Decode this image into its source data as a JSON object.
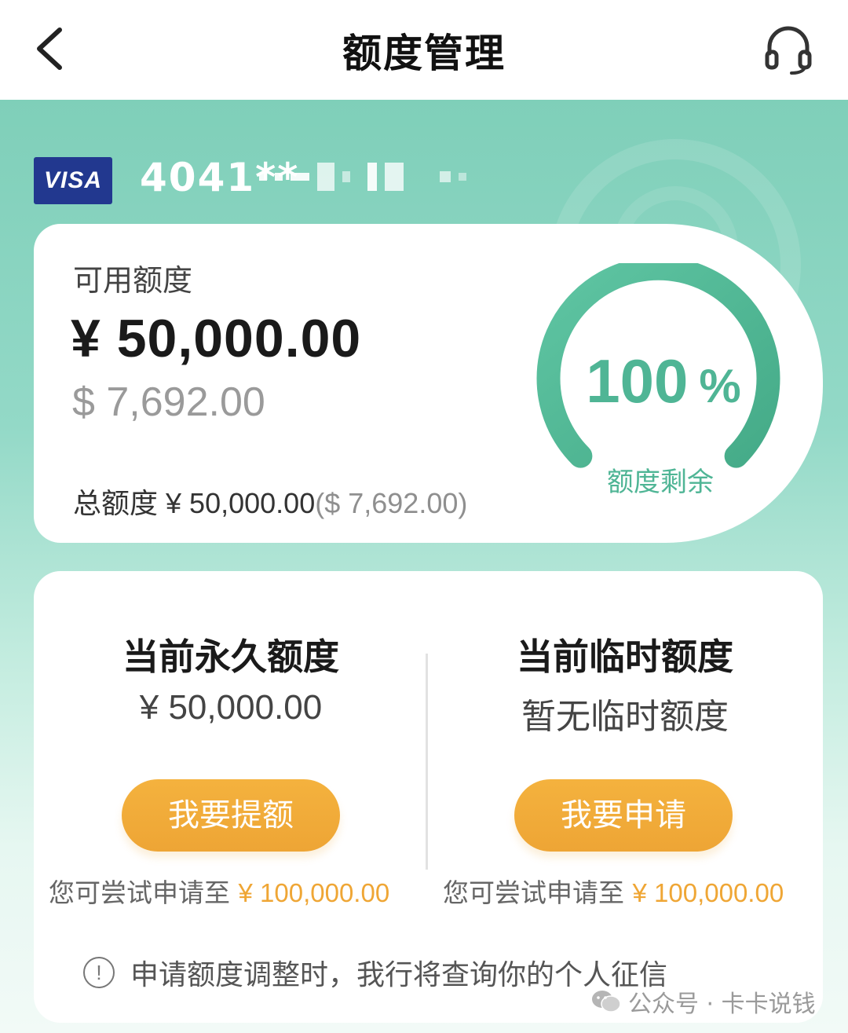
{
  "header": {
    "title": "额度管理"
  },
  "card": {
    "brand": "VISA",
    "number_prefix": "4041**"
  },
  "available": {
    "label": "可用额度",
    "amount_cny": "¥ 50,000.00",
    "amount_usd": "$ 7,692.00"
  },
  "total": {
    "label": "总额度",
    "amount_cny": "¥ 50,000.00",
    "amount_usd": "($ 7,692.00)"
  },
  "gauge": {
    "value": "100",
    "unit": "%",
    "label": "额度剩余",
    "fraction": 1.0
  },
  "permanent": {
    "title": "当前永久额度",
    "value": "¥ 50,000.00",
    "button": "我要提额",
    "hint_text": "您可尝试申请至",
    "hint_amount": "¥ 100,000.00"
  },
  "temporary": {
    "title": "当前临时额度",
    "value": "暂无临时额度",
    "button": "我要申请",
    "hint_text": "您可尝试申请至",
    "hint_amount": "¥ 100,000.00"
  },
  "notice": {
    "icon": "!",
    "text": "申请额度调整时，我行将查询你的个人征信"
  },
  "watermark": {
    "text": "公众号 · 卡卡说钱"
  },
  "colors": {
    "accent_green": "#4fb595",
    "button_orange": "#f0a838",
    "card_blue": "#22388f"
  }
}
